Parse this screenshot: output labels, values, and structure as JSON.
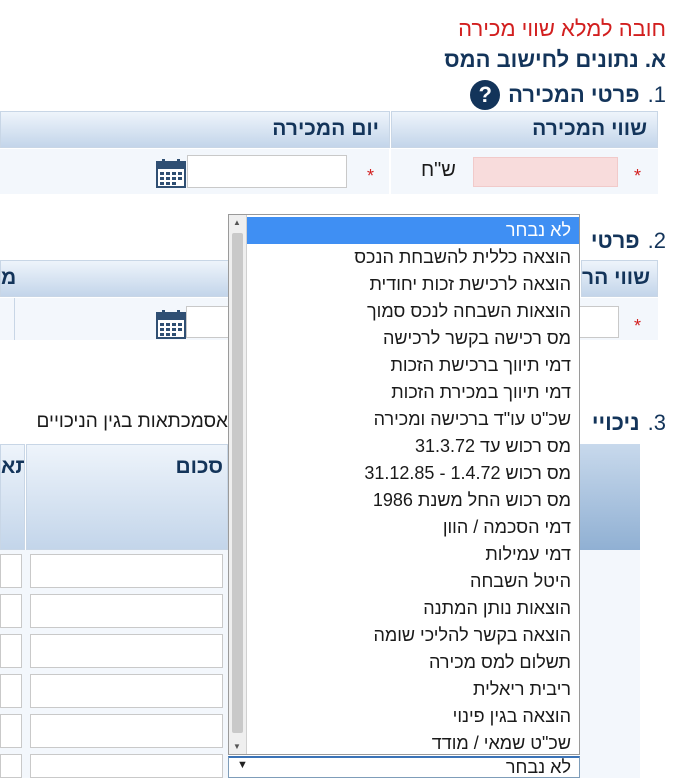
{
  "warning": "חובה למלא שווי מכירה",
  "section_a_title": "א. נתונים לחישוב המס",
  "sec1": {
    "num": "1.",
    "title": "פרטי המכירה"
  },
  "sec2": {
    "num": "2.",
    "title": "פרטי"
  },
  "sec3": {
    "num": "3.",
    "title": "ניכויי"
  },
  "table1": {
    "col_sale_value": "שווי המכירה",
    "col_sale_date": "יום המכירה",
    "currency": "ש\"ח",
    "required": "*"
  },
  "table2": {
    "col_value": "שווי הר",
    "col_left": "מ",
    "required": "*"
  },
  "table3": {
    "note": "אסמכתאות בגין הניכויים",
    "col_amount": "סכום",
    "col_left": "תא"
  },
  "listbox": {
    "options": [
      "לא נבחר",
      "הוצאה כללית להשבחת הנכס",
      "הוצאה לרכישת זכות יחודית",
      "הוצאות השבחה לנכס סמוך",
      "מס רכישה בקשר לרכישה",
      "דמי תיווך ברכישת הזכות",
      "דמי תיווך במכירת הזכות",
      "שכ\"ט עו\"ד ברכישה ומכירה",
      "מס רכוש עד 31.3.72",
      "מס רכוש 1.4.72 - 31.12.85",
      "מס רכוש החל משנת 1986",
      "דמי הסכמה / הוון",
      "דמי עמילות",
      "היטל השבחה",
      "הוצאות נותן המתנה",
      "הוצאה בקשר להליכי שומה",
      "תשלום למס מכירה",
      "ריבית ריאלית",
      "הוצאה בגין פינוי",
      "שכ\"ט שמאי / מודד"
    ],
    "selected_index": 0
  },
  "select": {
    "value": "לא נבחר"
  }
}
